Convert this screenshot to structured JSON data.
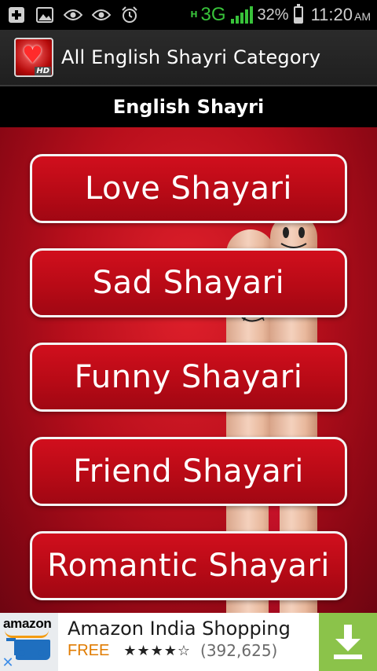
{
  "status_bar": {
    "network": "3G",
    "network_small": "H",
    "battery_percent": "32%",
    "battery_level": 0.32,
    "time": "11:20",
    "ampm": "AM",
    "icons": [
      "add-notification-icon",
      "image-icon",
      "eye-icon",
      "eye-icon",
      "alarm-icon"
    ]
  },
  "action_bar": {
    "app_icon_badge": "HD",
    "title": "All English Shayri Category"
  },
  "header": {
    "title": "English Shayri"
  },
  "categories": [
    {
      "label": "Love Shayari"
    },
    {
      "label": "Sad Shayari"
    },
    {
      "label": "Funny Shayari"
    },
    {
      "label": "Friend Shayari"
    },
    {
      "label": "Romantic Shayari"
    }
  ],
  "ad": {
    "logo_text": "amazon",
    "title": "Amazon India Shopping",
    "price": "FREE",
    "rating": 4.5,
    "stars": "★★★★☆",
    "reviews": "(392,625)",
    "close_symbol": "✕"
  },
  "colors": {
    "accent_red": "#b80a16",
    "status_green": "#38c23a",
    "ad_download_green": "#8bc34a",
    "ad_free_orange": "#e07b00"
  }
}
